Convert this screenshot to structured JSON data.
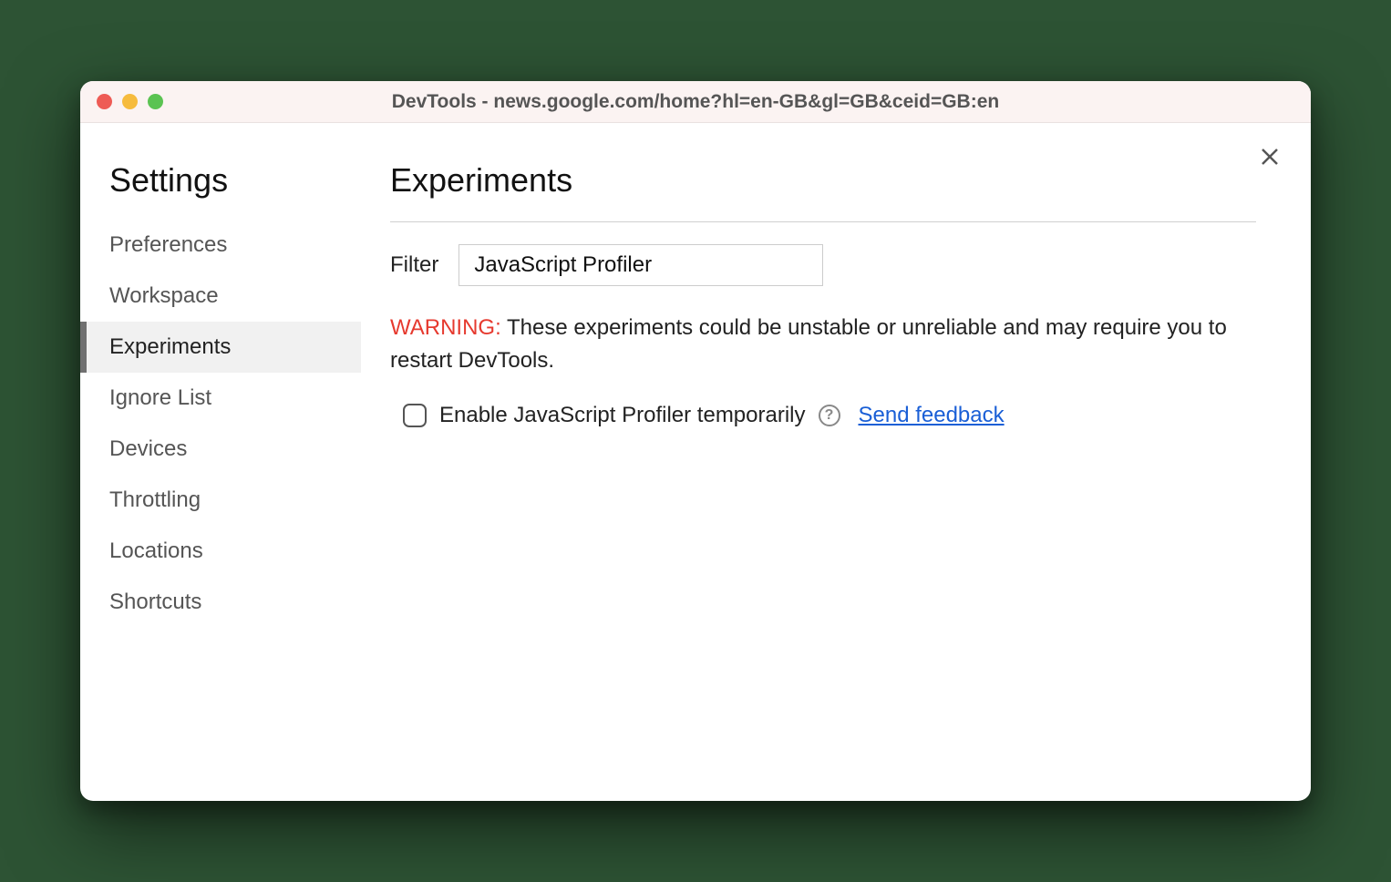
{
  "window": {
    "title": "DevTools - news.google.com/home?hl=en-GB&gl=GB&ceid=GB:en"
  },
  "sidebar": {
    "title": "Settings",
    "items": [
      {
        "label": "Preferences",
        "active": false
      },
      {
        "label": "Workspace",
        "active": false
      },
      {
        "label": "Experiments",
        "active": true
      },
      {
        "label": "Ignore List",
        "active": false
      },
      {
        "label": "Devices",
        "active": false
      },
      {
        "label": "Throttling",
        "active": false
      },
      {
        "label": "Locations",
        "active": false
      },
      {
        "label": "Shortcuts",
        "active": false
      }
    ]
  },
  "main": {
    "title": "Experiments",
    "filter_label": "Filter",
    "filter_value": "JavaScript Profiler",
    "warning_label": "WARNING:",
    "warning_text": " These experiments could be unstable or unreliable and may require you to restart DevTools.",
    "experiment": {
      "checked": false,
      "label": "Enable JavaScript Profiler temporarily",
      "help": "?",
      "feedback": "Send feedback"
    }
  }
}
